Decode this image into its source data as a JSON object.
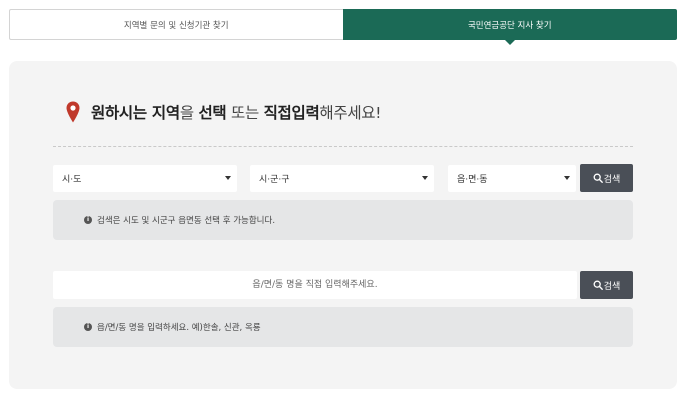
{
  "tabs": [
    {
      "label": "지역별 문의 및 신청기관 찾기",
      "active": false
    },
    {
      "label": "국민연금공단 지사 찾기",
      "active": true
    }
  ],
  "heading": {
    "part1": "원하시는 지역",
    "part2": "을 ",
    "part3": "선택",
    "part4": " 또는 ",
    "part5": "직접입력",
    "part6": "해주세요!"
  },
  "selects": {
    "sido": "시·도",
    "sigungu": "시·군·구",
    "eupmyeondong": "읍·면·동"
  },
  "search_button_label": "검색",
  "notice_select": "검색은 시도 및 시군구 읍면동 선택 후 가능합니다.",
  "direct_input": {
    "placeholder": "읍/면/동 명을 직접 입력해주세요.",
    "value": ""
  },
  "notice_input": "읍/면/동 명을 입력하세요. 예)한솔, 신관, 옥룡",
  "colors": {
    "active_tab": "#1b6a56",
    "button": "#4a4f57",
    "pin": "#c0392b",
    "panel": "#f4f4f4"
  }
}
